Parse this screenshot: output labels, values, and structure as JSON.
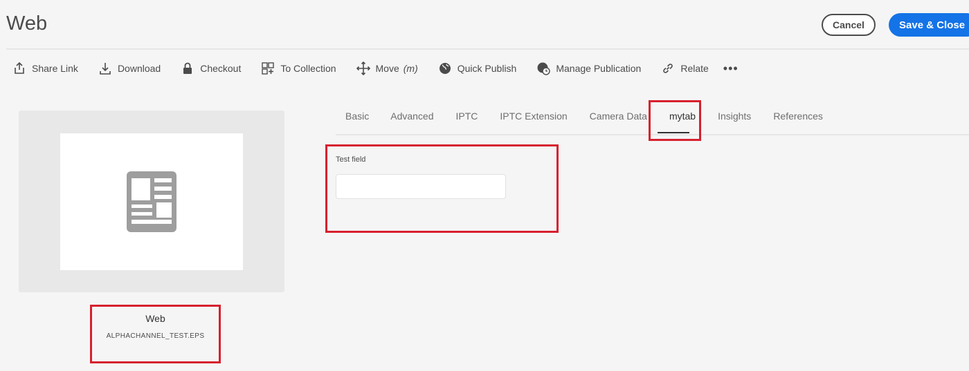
{
  "header": {
    "title": "Web",
    "cancel_label": "Cancel",
    "save_label": "Save & Close"
  },
  "toolbar": {
    "items": [
      {
        "label": "Share Link",
        "icon": "share-icon"
      },
      {
        "label": "Download",
        "icon": "download-icon"
      },
      {
        "label": "Checkout",
        "icon": "lock-icon"
      },
      {
        "label": "To Collection",
        "icon": "collection-add-icon"
      },
      {
        "label": "Move",
        "suffix": "(m)",
        "icon": "move-icon"
      },
      {
        "label": "Quick Publish",
        "icon": "globe-icon"
      },
      {
        "label": "Manage Publication",
        "icon": "globe-clock-icon"
      },
      {
        "label": "Relate",
        "icon": "link-icon"
      }
    ],
    "more_label": "•••"
  },
  "asset": {
    "title": "Web",
    "filename": "ALPHACHANNEL_TEST.EPS",
    "thumbnail_icon": "document-icon"
  },
  "tabs": [
    {
      "label": "Basic"
    },
    {
      "label": "Advanced"
    },
    {
      "label": "IPTC"
    },
    {
      "label": "IPTC Extension"
    },
    {
      "label": "Camera Data"
    },
    {
      "label": "mytab"
    },
    {
      "label": "Insights"
    },
    {
      "label": "References"
    }
  ],
  "active_tab": "mytab",
  "form": {
    "test_field_label": "Test field",
    "test_field_value": ""
  },
  "colors": {
    "accent": "#1473e6",
    "highlight": "#d7202e"
  }
}
